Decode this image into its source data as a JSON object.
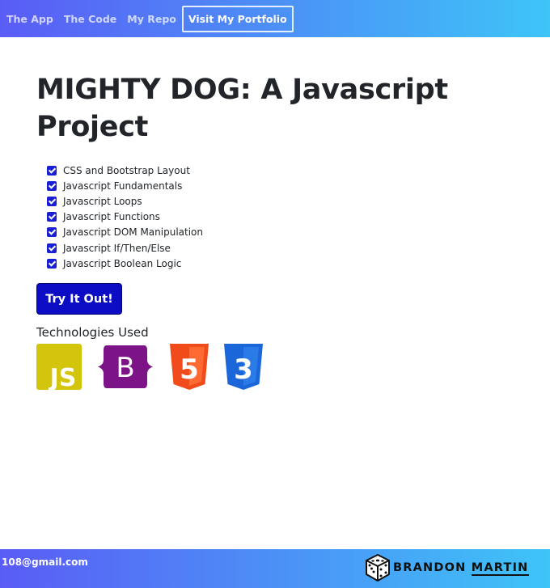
{
  "navbar": {
    "links": [
      "The App",
      "The Code",
      "My Repo"
    ],
    "portfolio_label": "Visit My Portfolio"
  },
  "main": {
    "title_line1": "MIGHTY DOG: A Javascript",
    "title_line2": "Project",
    "features": [
      "CSS and Bootstrap Layout",
      "Javascript Fundamentals",
      "Javascript Loops",
      "Javascript Functions",
      "Javascript DOM Manipulation",
      "Javascript If/Then/Else",
      "Javascript Boolean Logic"
    ],
    "try_button_label": "Try It Out!",
    "technologies_heading": "Technologies Used",
    "technologies": [
      {
        "icon": "javascript-logo-icon",
        "text": "JS",
        "color": "#d3c40c"
      },
      {
        "icon": "bootstrap-logo-icon",
        "text": "B",
        "color": "#7c1488"
      },
      {
        "icon": "html5-logo-icon",
        "text": "5",
        "color": "#f14b1c"
      },
      {
        "icon": "css3-logo-icon",
        "text": "3",
        "color": "#1b66d8"
      }
    ]
  },
  "footer": {
    "email": "108@gmail.com",
    "brand_first": "BRANDON",
    "brand_last": "MARTIN",
    "brand_icon": "dice-logo-icon"
  },
  "colors": {
    "gradient_start": "#5a5cf6",
    "gradient_end": "#3ec4f7",
    "button": "#0c0cc4",
    "checkbox": "#1a1fd1"
  }
}
